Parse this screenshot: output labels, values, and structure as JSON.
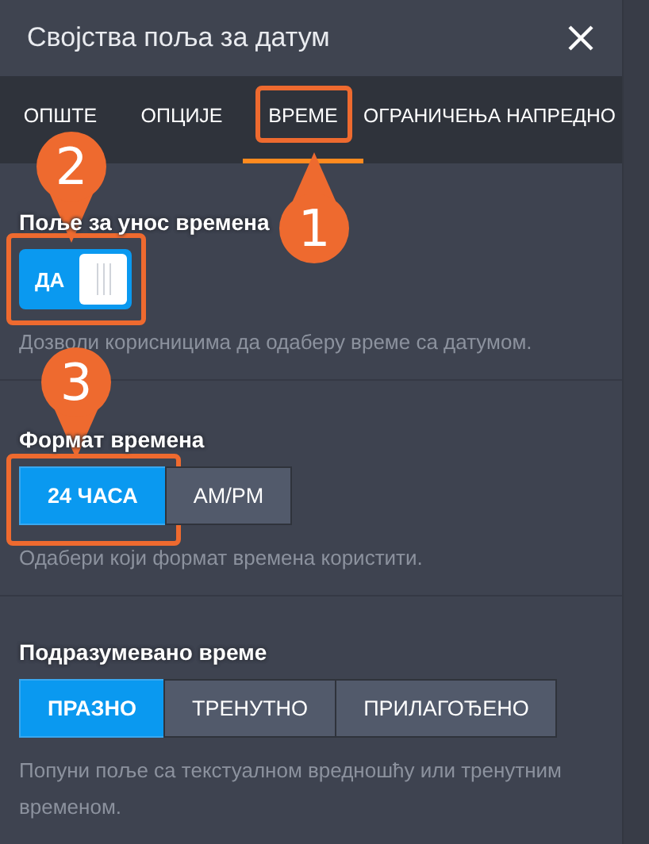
{
  "window": {
    "title": "Својства поља за датум"
  },
  "tabs": [
    {
      "label": "ОПШТЕ",
      "selected": false,
      "highlighted": false
    },
    {
      "label": "ОПЦИЈЕ",
      "selected": false,
      "highlighted": false
    },
    {
      "label": "ВРЕМЕ",
      "selected": true,
      "highlighted": true,
      "callout": "1"
    },
    {
      "label": "ОГРАНИЧЕЊА НАПРЕДНО",
      "selected": false,
      "highlighted": false
    }
  ],
  "sections": [
    {
      "kind": "toggle",
      "label": "Поље за унос времена",
      "toggle": {
        "label": "ДА",
        "on": true,
        "highlighted": true,
        "callout": "2"
      },
      "description": "Дозволи корисницима да одаберу време са датумом."
    },
    {
      "kind": "segmented",
      "label": "Формат времена",
      "options": [
        {
          "label": "24 ЧАСА",
          "selected": true,
          "highlighted": true,
          "callout": "3"
        },
        {
          "label": "AM/PM",
          "selected": false,
          "highlighted": false
        }
      ],
      "description": "Одабери који формат времена користити."
    },
    {
      "kind": "segmented",
      "label": "Подразумевано време",
      "options": [
        {
          "label": "ПРАЗНО",
          "selected": true,
          "highlighted": false
        },
        {
          "label": "ТРЕНУТНО",
          "selected": false,
          "highlighted": false
        },
        {
          "label": "ПРИЛАГОЂЕНО",
          "selected": false,
          "highlighted": false
        }
      ],
      "description": "Попуни поље са текстуалном вредношћу или тренутним временом."
    }
  ]
}
